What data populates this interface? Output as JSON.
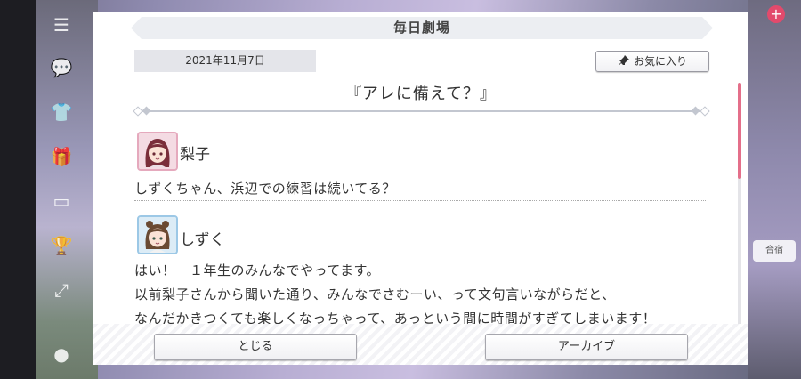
{
  "dialog": {
    "header_title": "毎日劇場",
    "date": "2021年11月7日",
    "favorite_label": "お気に入り",
    "episode_title": "『アレに備えて？』"
  },
  "entries": [
    {
      "speaker": "梨子",
      "lines": [
        "しずくちゃん、浜辺での練習は続いてる？"
      ]
    },
    {
      "speaker": "しずく",
      "lines": [
        "はい！　１年生のみんなでやってます。",
        "以前梨子さんから聞いた通り、みんなでさむーい、って文句言いながらだと、",
        "なんだかきつくても楽しくなっちゃって、あっという間に時間がすぎてしまいます！"
      ]
    }
  ],
  "buttons": {
    "close_label": "とじる",
    "archive_label": "アーカイブ"
  },
  "background": {
    "badge": "+",
    "card_label": "合宿"
  },
  "colors": {
    "accent_pink": "#e46f8a",
    "riko_frame": "#e5a9bd",
    "shizuku_frame": "#9cc8e6"
  },
  "icons": {
    "menu": "menu-icon",
    "pin": "pin-icon"
  }
}
